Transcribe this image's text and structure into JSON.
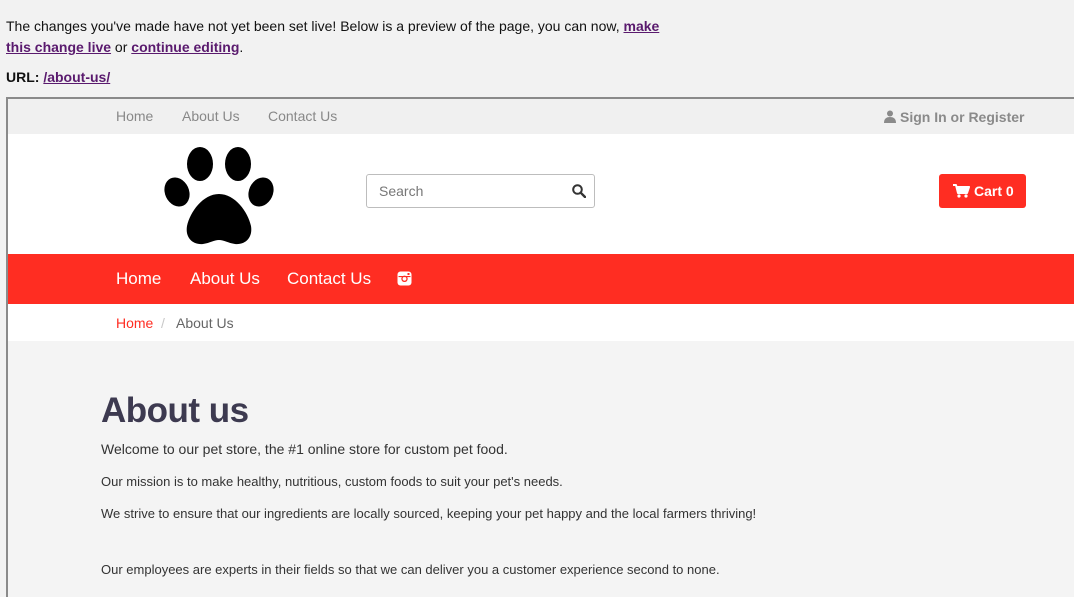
{
  "notice": {
    "text_before": "The changes you've made have not yet been set live! Below is a preview of the page, you can now, ",
    "make_live_link": "make this change live",
    "text_middle": " or ",
    "continue_link": "continue editing",
    "text_after": "."
  },
  "url": {
    "label": "URL:",
    "value": "/about-us/"
  },
  "site": {
    "top_nav": [
      "Home",
      "About Us",
      "Contact Us"
    ],
    "sign_in": "Sign In or Register",
    "search_placeholder": "Search",
    "cart_label": "Cart 0",
    "main_nav": [
      "Home",
      "About Us",
      "Contact Us"
    ],
    "breadcrumb": {
      "home": "Home",
      "separator": "/",
      "current": "About Us"
    },
    "accent_color": "#ff2d22",
    "icons": [
      "user-icon",
      "paw-logo",
      "search-icon",
      "cart-icon",
      "instagram-icon"
    ]
  },
  "content": {
    "heading": "About us",
    "paragraphs": [
      "Welcome to our pet store, the #1 online store for custom pet food.",
      "Our mission is to make healthy, nutritious, custom foods to suit your pet's needs.",
      "We strive to ensure that our ingredients are locally sourced, keeping your pet happy and the local farmers thriving!",
      "Our employees are experts in their fields so that we can deliver you a customer experience second to none."
    ]
  }
}
